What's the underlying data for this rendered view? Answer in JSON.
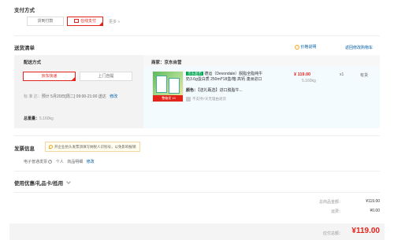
{
  "payment": {
    "title": "支付方式",
    "options": [
      "货到付款",
      "在线支付"
    ],
    "selected_index": 1,
    "more": "更多 »"
  },
  "delivery": {
    "title": "送货清单",
    "price_note": "价格说明",
    "back_to_cart": "返回修改购物车",
    "method_label": "配送方式",
    "methods": [
      "京东快递",
      "上门自提"
    ],
    "selected_method_index": 0,
    "time_label": "标  准  达：",
    "time_value": "预计 5月20日[周二] 09:00-21:00 送达",
    "time_edit": "修改",
    "weight_label": "总重量：",
    "weight_value": "5.160kg"
  },
  "merchant": {
    "label": "商家：京东自营",
    "item": {
      "badge": "京东超市",
      "name": "德运（Devondale）脱脂全脂纯牛奶3.6g蛋白质 250ml*18盒/箱 高钙 澳洲进口",
      "color_label": "颜色：",
      "color_value": "【送礼甄选】进口脱脂牛...",
      "return_note": "不支持7天无理由退货",
      "price": "¥ 119.00",
      "weight": "5.160kg",
      "qty": "x1",
      "stock": "有货",
      "image_label": "整箱发 19"
    }
  },
  "invoice": {
    "title": "发票信息",
    "tip": "开企业抬头发票须填写纳税人识别号，以免影响报销",
    "type": "电子普通发票",
    "header": "个人",
    "content": "商品明细",
    "edit": "修改"
  },
  "coupon": {
    "title": "使用优惠/礼品卡/抵用"
  },
  "summary": {
    "total_label": "总商品金额：",
    "total_value": "¥119.00",
    "shipping_label": "运费：",
    "shipping_value": "¥0.00",
    "payable_label": "应付总额：",
    "payable_value": "¥119.00"
  },
  "colors": {
    "accent": "#e2231a",
    "link": "#005ea7",
    "panel": "#f3f3f3",
    "item_bg": "#f3fbfe",
    "jd_green": "#00a651"
  }
}
